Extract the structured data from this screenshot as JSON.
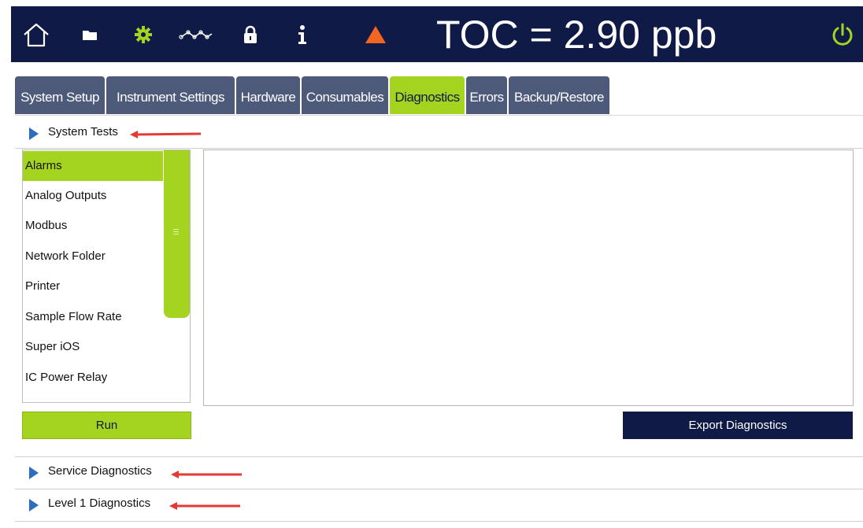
{
  "topbar": {
    "icons": [
      "home-icon",
      "folder-icon",
      "gear-icon",
      "trend-icon",
      "lock-icon",
      "info-icon",
      "warning-icon",
      "power-icon"
    ],
    "reading": "TOC = 2.90 ppb"
  },
  "tabs": [
    {
      "label": "System Setup",
      "active": false
    },
    {
      "label": "Instrument Settings",
      "active": false
    },
    {
      "label": "Hardware",
      "active": false
    },
    {
      "label": "Consumables",
      "active": false
    },
    {
      "label": "Diagnostics",
      "active": true
    },
    {
      "label": "Errors",
      "active": false
    },
    {
      "label": "Backup/Restore",
      "active": false
    }
  ],
  "system_tests": {
    "title": "System Tests",
    "items": [
      "Alarms",
      "Analog Outputs",
      "Modbus",
      "Network Folder",
      "Printer",
      "Sample Flow Rate",
      "Super iOS",
      "IC Power Relay"
    ],
    "selected": "Alarms",
    "run_label": "Run",
    "export_label": "Export Diagnostics"
  },
  "service_diagnostics": {
    "title": "Service Diagnostics"
  },
  "level1_diagnostics": {
    "title": "Level 1 Diagnostics"
  },
  "colors": {
    "navy": "#0f1a46",
    "accent_green": "#a4d420",
    "tab_gray": "#4d5a7a",
    "warning": "#f26522",
    "triangle_blue": "#2c6dbf",
    "annotation_red": "#e53935"
  }
}
